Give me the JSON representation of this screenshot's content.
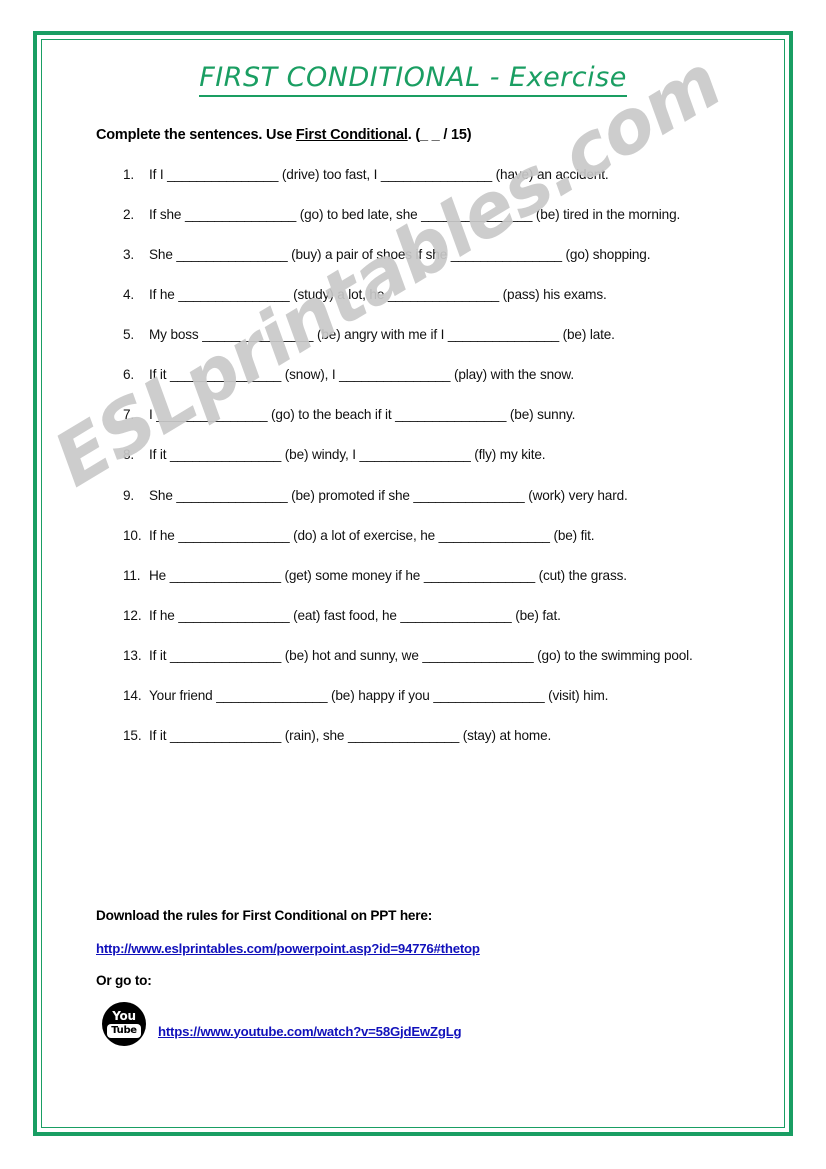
{
  "page": {
    "border_color": "#199e63",
    "background": "#ffffff"
  },
  "title": "FIRST CONDITIONAL - Exercise",
  "instruction": {
    "before": "Complete the sentences. Use ",
    "underlined": "First Conditional",
    "after": ". (_ _ / 15)"
  },
  "exercises": [
    {
      "num": "1.",
      "text": "If I _______________ (drive) too fast, I _______________ (have) an accident."
    },
    {
      "num": "2.",
      "text": "If she _______________ (go) to bed late, she _______________ (be) tired in the morning."
    },
    {
      "num": "3.",
      "text": "She _______________ (buy) a pair of shoes if she _______________ (go) shopping."
    },
    {
      "num": "4.",
      "text": "If he _______________ (study) a lot, he _______________ (pass) his exams."
    },
    {
      "num": "5.",
      "text": "My boss _______________ (be) angry with me if I _______________ (be) late."
    },
    {
      "num": "6.",
      "text": "If it _______________ (snow), I _______________ (play) with the snow."
    },
    {
      "num": "7.",
      "text": "I _______________ (go) to the beach if it _______________ (be) sunny."
    },
    {
      "num": "8.",
      "text": "If it _______________ (be) windy, I _______________ (fly) my kite."
    },
    {
      "num": "9.",
      "text": "She _______________ (be) promoted if she _______________ (work) very hard."
    },
    {
      "num": "10.",
      "text": "If he _______________ (do) a lot of exercise, he _______________ (be) fit."
    },
    {
      "num": "11.",
      "text": "He _______________ (get) some money if he _______________ (cut) the grass."
    },
    {
      "num": "12.",
      "text": "If he _______________ (eat) fast food, he _______________ (be) fat."
    },
    {
      "num": "13.",
      "text": "If it _______________ (be) hot and sunny, we _______________ (go) to the swimming pool."
    },
    {
      "num": "14.",
      "text": "Your friend _______________ (be) happy if you _______________ (visit) him."
    },
    {
      "num": "15.",
      "text": "If it _______________ (rain), she _______________ (stay) at home."
    }
  ],
  "footer": {
    "heading": "Download the rules for First Conditional on PPT here:",
    "ppt_link": "http://www.eslprintables.com/powerpoint.asp?id=94776#thetop",
    "or_go_to": "Or go to:",
    "youtube_icon": {
      "top": "You",
      "bottom": "Tube"
    },
    "youtube_link": "https://www.youtube.com/watch?v=58GjdEwZgLg"
  },
  "watermark": "ESLprintables.com"
}
